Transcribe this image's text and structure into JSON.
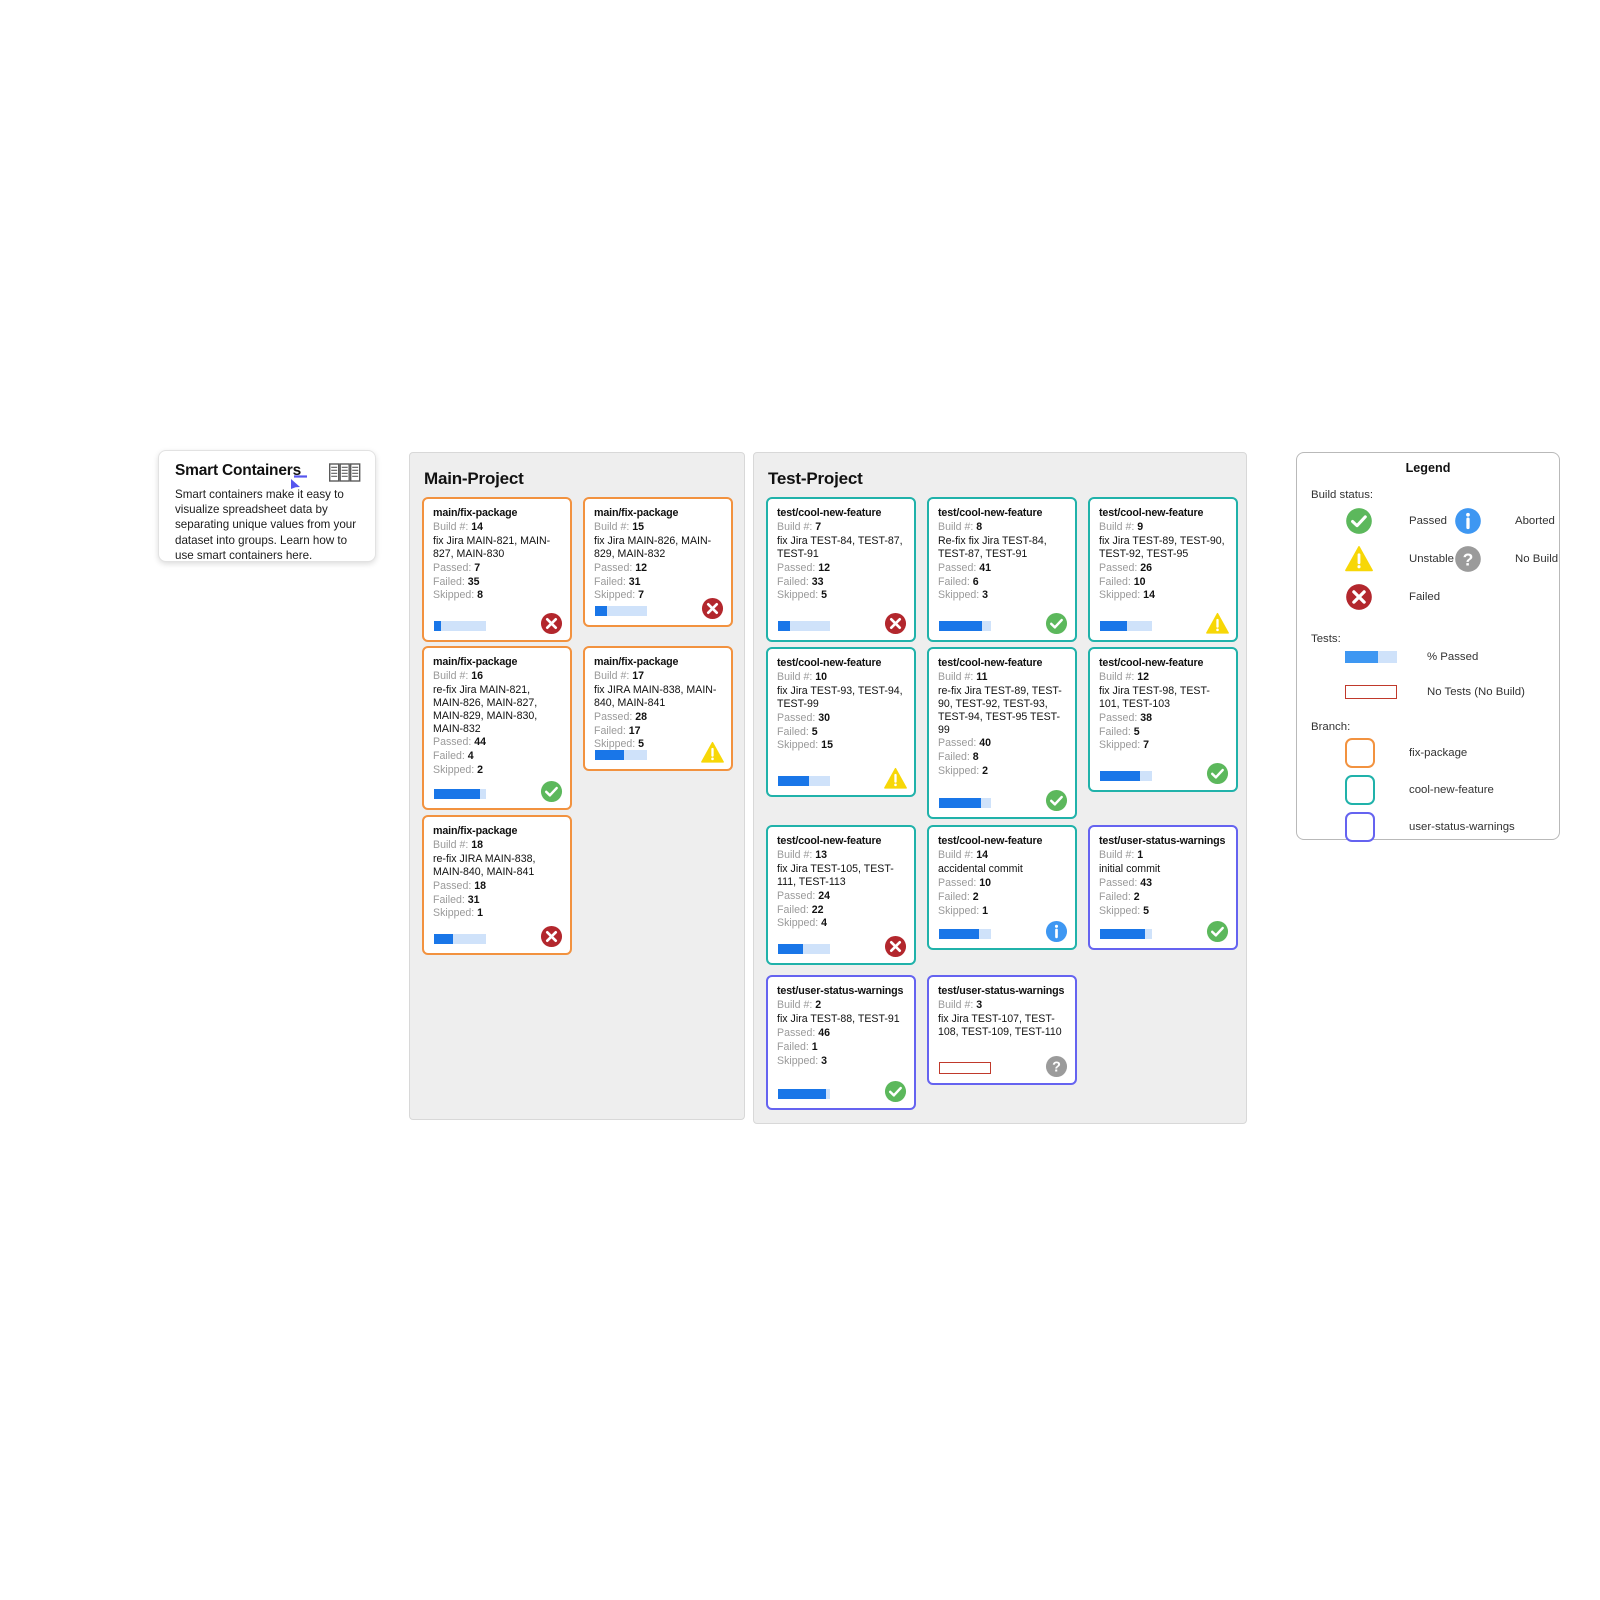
{
  "callout": {
    "title": "Smart Containers",
    "body": "Smart containers make it easy to visualize spreadsheet data by separating unique values from your dataset into groups. Learn how to use smart containers here.",
    "icon": "columns-table-icon",
    "cursor": "cursor-arrow-icon"
  },
  "panels": [
    {
      "id": "main",
      "title": "Main-Project",
      "cards": [
        {
          "branch": "main/fix-package",
          "branch_key": "fix",
          "build_label": "Build #:",
          "build": "14",
          "commit": "fix Jira MAIN-821, MAIN-827, MAIN-830",
          "passed_label": "Passed:",
          "passed": "7",
          "failed_label": "Failed:",
          "failed": "35",
          "skipped_label": "Skipped:",
          "skipped": "8",
          "pct": 14,
          "status": "failed"
        },
        {
          "branch": "main/fix-package",
          "branch_key": "fix",
          "build_label": "Build #:",
          "build": "15",
          "commit": "fix Jira MAIN-826, MAIN-829, MAIN-832",
          "passed_label": "Passed:",
          "passed": "12",
          "failed_label": "Failed:",
          "failed": "31",
          "skipped_label": "Skipped:",
          "skipped": "7",
          "pct": 24,
          "status": "failed"
        },
        {
          "branch": "main/fix-package",
          "branch_key": "fix",
          "build_label": "Build #:",
          "build": "16",
          "commit": "re-fix Jira MAIN-821, MAIN-826, MAIN-827, MAIN-829, MAIN-830, MAIN-832",
          "passed_label": "Passed:",
          "passed": "44",
          "failed_label": "Failed:",
          "failed": "4",
          "skipped_label": "Skipped:",
          "skipped": "2",
          "pct": 88,
          "status": "passed"
        },
        {
          "branch": "main/fix-package",
          "branch_key": "fix",
          "build_label": "Build #:",
          "build": "17",
          "commit": "fix JIRA MAIN-838, MAIN-840, MAIN-841",
          "passed_label": "Passed:",
          "passed": "28",
          "failed_label": "Failed:",
          "failed": "17",
          "skipped_label": "Skipped:",
          "skipped": "5",
          "pct": 56,
          "status": "unstable"
        },
        {
          "branch": "main/fix-package",
          "branch_key": "fix",
          "build_label": "Build #:",
          "build": "18",
          "commit": "re-fix JIRA MAIN-838, MAIN-840, MAIN-841",
          "passed_label": "Passed:",
          "passed": "18",
          "failed_label": "Failed:",
          "failed": "31",
          "skipped_label": "Skipped:",
          "skipped": "1",
          "pct": 36,
          "status": "failed"
        }
      ]
    },
    {
      "id": "test",
      "title": "Test-Project",
      "cards": [
        {
          "branch": "test/cool-new-feature",
          "branch_key": "cool",
          "build_label": "Build #:",
          "build": "7",
          "commit": "fix Jira TEST-84, TEST-87, TEST-91",
          "passed_label": "Passed:",
          "passed": "12",
          "failed_label": "Failed:",
          "failed": "33",
          "skipped_label": "Skipped:",
          "skipped": "5",
          "pct": 24,
          "status": "failed"
        },
        {
          "branch": "test/cool-new-feature",
          "branch_key": "cool",
          "build_label": "Build #:",
          "build": "8",
          "commit": "Re-fix fix Jira TEST-84, TEST-87, TEST-91",
          "passed_label": "Passed:",
          "passed": "41",
          "failed_label": "Failed:",
          "failed": "6",
          "skipped_label": "Skipped:",
          "skipped": "3",
          "pct": 82,
          "status": "passed"
        },
        {
          "branch": "test/cool-new-feature",
          "branch_key": "cool",
          "build_label": "Build #:",
          "build": "9",
          "commit": "fix Jira TEST-89, TEST-90, TEST-92, TEST-95",
          "passed_label": "Passed:",
          "passed": "26",
          "failed_label": "Failed:",
          "failed": "10",
          "skipped_label": "Skipped:",
          "skipped": "14",
          "pct": 52,
          "status": "unstable"
        },
        {
          "branch": "test/cool-new-feature",
          "branch_key": "cool",
          "build_label": "Build #:",
          "build": "10",
          "commit": "fix Jira TEST-93, TEST-94, TEST-99",
          "passed_label": "Passed:",
          "passed": "30",
          "failed_label": "Failed:",
          "failed": "5",
          "skipped_label": "Skipped:",
          "skipped": "15",
          "pct": 60,
          "status": "unstable"
        },
        {
          "branch": "test/cool-new-feature",
          "branch_key": "cool",
          "build_label": "Build #:",
          "build": "11",
          "commit": "re-fix Jira TEST-89, TEST-90, TEST-92, TEST-93, TEST-94, TEST-95 TEST-99",
          "passed_label": "Passed:",
          "passed": "40",
          "failed_label": "Failed:",
          "failed": "8",
          "skipped_label": "Skipped:",
          "skipped": "2",
          "pct": 80,
          "status": "passed"
        },
        {
          "branch": "test/cool-new-feature",
          "branch_key": "cool",
          "build_label": "Build #:",
          "build": "12",
          "commit": "fix Jira TEST-98, TEST-101, TEST-103",
          "passed_label": "Passed:",
          "passed": "38",
          "failed_label": "Failed:",
          "failed": "5",
          "skipped_label": "Skipped:",
          "skipped": "7",
          "pct": 76,
          "status": "passed"
        },
        {
          "branch": "test/cool-new-feature",
          "branch_key": "cool",
          "build_label": "Build #:",
          "build": "13",
          "commit": "fix Jira TEST-105, TEST-111, TEST-113",
          "passed_label": "Passed:",
          "passed": "24",
          "failed_label": "Failed:",
          "failed": "22",
          "skipped_label": "Skipped:",
          "skipped": "4",
          "pct": 48,
          "status": "failed"
        },
        {
          "branch": "test/cool-new-feature",
          "branch_key": "cool",
          "build_label": "Build #:",
          "build": "14",
          "commit": "accidental commit",
          "passed_label": "Passed:",
          "passed": "10",
          "failed_label": "Failed:",
          "failed": "2",
          "skipped_label": "Skipped:",
          "skipped": "1",
          "pct": 77,
          "status": "aborted"
        },
        {
          "branch": "test/user-status-warnings",
          "branch_key": "user",
          "build_label": "Build #:",
          "build": "1",
          "commit": "initial commit",
          "passed_label": "Passed:",
          "passed": "43",
          "failed_label": "Failed:",
          "failed": "2",
          "skipped_label": "Skipped:",
          "skipped": "5",
          "pct": 86,
          "status": "passed"
        },
        {
          "branch": "test/user-status-warnings",
          "branch_key": "user",
          "build_label": "Build #:",
          "build": "2",
          "commit": "fix Jira TEST-88, TEST-91",
          "passed_label": "Passed:",
          "passed": "46",
          "failed_label": "Failed:",
          "failed": "1",
          "skipped_label": "Skipped:",
          "skipped": "3",
          "pct": 92,
          "status": "passed"
        },
        {
          "branch": "test/user-status-warnings",
          "branch_key": "user",
          "build_label": "Build #:",
          "build": "3",
          "commit": "fix Jira TEST-107, TEST-108, TEST-109, TEST-110",
          "passed_label": "",
          "passed": "",
          "failed_label": "",
          "failed": "",
          "skipped_label": "",
          "skipped": "",
          "pct": -1,
          "status": "nobuild"
        }
      ]
    }
  ],
  "legend": {
    "title": "Legend",
    "build_status_label": "Build status:",
    "build_status": [
      {
        "key": "passed",
        "label": "Passed",
        "color": "#5cb85c"
      },
      {
        "key": "aborted",
        "label": "Aborted",
        "color": "#3e97f2"
      },
      {
        "key": "unstable",
        "label": "Unstable",
        "color": "#f5d800"
      },
      {
        "key": "nobuild",
        "label": "No Build",
        "color": "#9b9b9b"
      },
      {
        "key": "failed",
        "label": "Failed",
        "color": "#c0392b"
      }
    ],
    "tests_label": "Tests:",
    "tests": [
      {
        "key": "pct-passed",
        "label": "% Passed"
      },
      {
        "key": "no-tests",
        "label": "No Tests (No Build)"
      }
    ],
    "branch_label": "Branch:",
    "branches": [
      {
        "key": "fix",
        "label": "fix-package",
        "color": "#f2923f"
      },
      {
        "key": "cool",
        "label": "cool-new-feature",
        "color": "#20b2aa"
      },
      {
        "key": "user",
        "label": "user-status-warnings",
        "color": "#6563f0"
      }
    ]
  },
  "colors": {
    "bar_fill": "#1976e8",
    "bar_track": "#cfe2fa",
    "panel_bg": "#eeeeee",
    "no_tests_border": "#c0392b"
  }
}
